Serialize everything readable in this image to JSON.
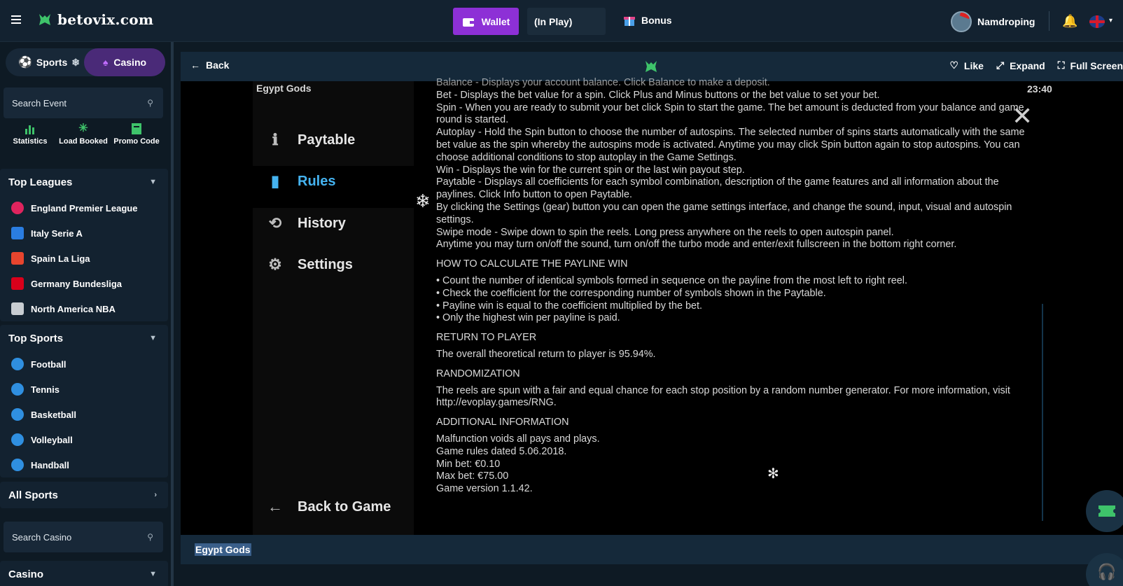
{
  "header": {
    "site_name": "betovix.com",
    "wallet_label": "Wallet",
    "in_play_label": "(In Play)",
    "bonus_label": "Bonus",
    "username": "Namdroping"
  },
  "sidebar": {
    "tab_sports": "Sports",
    "tab_casino": "Casino",
    "search_event_placeholder": "Search Event",
    "quick_links": [
      {
        "label": "Statistics"
      },
      {
        "label": "Load Booked"
      },
      {
        "label": "Promo Code"
      }
    ],
    "top_leagues_title": "Top Leagues",
    "top_leagues": [
      {
        "label": "England Premier League"
      },
      {
        "label": "Italy Serie A"
      },
      {
        "label": "Spain La Liga"
      },
      {
        "label": "Germany Bundesliga"
      },
      {
        "label": "North America NBA"
      }
    ],
    "top_sports_title": "Top Sports",
    "top_sports": [
      {
        "label": "Football"
      },
      {
        "label": "Tennis"
      },
      {
        "label": "Basketball"
      },
      {
        "label": "Volleyball"
      },
      {
        "label": "Handball"
      }
    ],
    "all_sports_label": "All Sports",
    "search_casino_placeholder": "Search Casino",
    "casino_label": "Casino"
  },
  "game_toolbar": {
    "back_label": "Back",
    "like_label": "Like",
    "expand_label": "Expand",
    "fullscreen_label": "Full Screen"
  },
  "game": {
    "title": "Egypt Gods",
    "clock": "23:40",
    "menu": {
      "paytable": "Paytable",
      "rules": "Rules",
      "history": "History",
      "settings": "Settings",
      "back_to_game": "Back to Game"
    },
    "rules": {
      "lines_top": [
        "Balance - Displays your account balance. Click Balance to make a deposit.",
        "Bet - Displays the bet value for a spin. Click Plus and Minus buttons or the bet value to set your bet.",
        "Spin - When you are ready to submit your bet click Spin to start the game. The bet amount is deducted from your balance and game round is started.",
        "Autoplay - Hold the Spin button to choose the number of autospins. The selected number of spins starts automatically with the same bet value as the spin whereby the autospins mode is activated. Anytime you may click Spin button again to stop autospins. You can choose additional conditions to stop autoplay in the Game Settings.",
        "Win - Displays the win for the current spin or the last win payout step.",
        "Paytable - Displays all coefficients for each symbol combination, description of the game features and all information about the paylines. Click Info button to open Paytable.",
        "By clicking the Settings (gear) button you can open the game settings interface, and change the sound, input, visual and autospin settings.",
        "Swipe mode - Swipe down to spin the reels. Long press anywhere on the reels to open autospin panel.",
        "Anytime you may turn on/off the sound, turn on/off the turbo mode and enter/exit fullscreen in the bottom right corner."
      ],
      "payline_heading": "HOW TO CALCULATE THE PAYLINE WIN",
      "payline_items": [
        "• Count the number of identical symbols formed in sequence on the payline from the most left to right reel.",
        "• Check the coefficient for the corresponding number of symbols shown in the Paytable.",
        "• Payline win is equal to the coefficient multiplied by the bet.",
        "• Only the highest win per payline is paid."
      ],
      "rtp_heading": "RETURN TO PLAYER",
      "rtp_text": "The overall theoretical return to player is 95.94%.",
      "random_heading": "RANDOMIZATION",
      "random_text": "The reels are spun with a fair and equal chance for each stop position by a random number generator. For more information, visit http://evoplay.games/RNG.",
      "additional_heading": "ADDITIONAL INFORMATION",
      "additional_lines": [
        "Malfunction voids all pays and plays.",
        "Game rules dated 5.06.2018.",
        "Min bet: €0.10",
        "Max bet: €75.00",
        "Game version 1.1.42."
      ]
    }
  },
  "bottom_bar": {
    "game_title": "Egypt Gods"
  },
  "colors": {
    "accent_purple": "#8d30d6",
    "casino_tab": "#4a2a78",
    "rules_active": "#45b3f0",
    "brand_green": "#3ec36a"
  }
}
